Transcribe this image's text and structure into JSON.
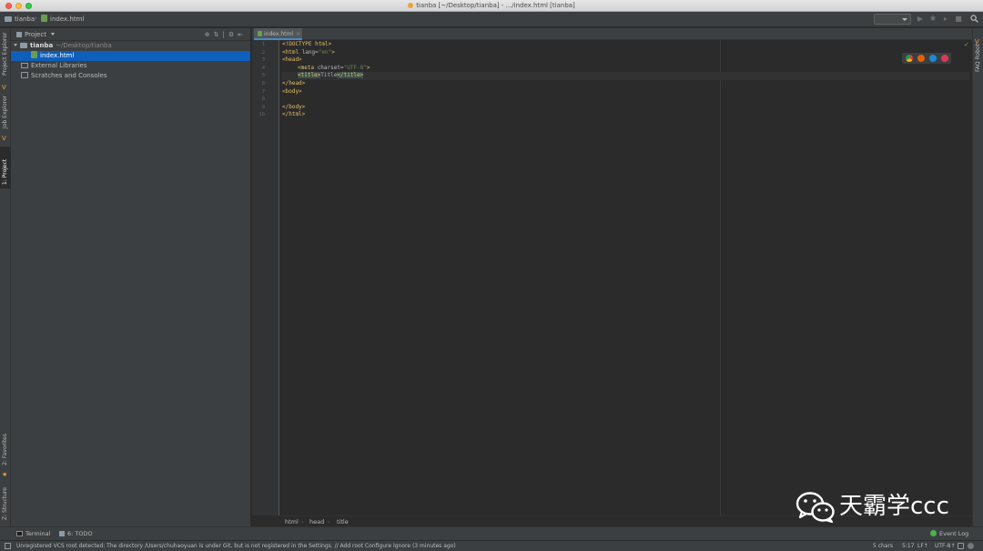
{
  "window": {
    "title": "tianba [~/Desktop/tianba] - .../index.html [tianba]"
  },
  "navbar": {
    "crumbs": [
      "tianba",
      "index.html"
    ]
  },
  "left_strip": {
    "tabs": [
      "Project Explorer",
      "Job Explorer",
      "1: Project",
      "2: Favorites",
      "Z: Structure"
    ]
  },
  "project_panel": {
    "title": "Project",
    "tree": {
      "root_name": "tianba",
      "root_path": "~/Desktop/tianba",
      "file": "index.html",
      "external": "External Libraries",
      "scratches": "Scratches and Consoles"
    }
  },
  "editor": {
    "tab_label": "index.html",
    "line_numbers": [
      "1",
      "2",
      "3",
      "4",
      "5",
      "6",
      "7",
      "8",
      "9",
      "10"
    ],
    "code": {
      "l1_tag": "<!DOCTYPE html>",
      "l2_open": "<html ",
      "l2_attr": "lang=",
      "l2_val": "\"en\"",
      "l2_close": ">",
      "l3": "<head>",
      "l4_open": "<meta ",
      "l4_attr": "charset=",
      "l4_val": "\"UTF-8\"",
      "l4_close": ">",
      "l5_open": "<title>",
      "l5_text": "Title",
      "l5_close": "</title>",
      "l6": "</head>",
      "l7": "<body>",
      "l9": "</body>",
      "l10": "</html>"
    },
    "breadcrumbs": [
      "html",
      "head",
      "title"
    ]
  },
  "right_strip": {
    "tabs": [
      "FAQ Robot"
    ]
  },
  "bottom_bar": {
    "terminal": "Terminal",
    "todo": "6: TODO",
    "event_log": "Event Log"
  },
  "status_bar": {
    "message": "Unregistered VCS root detected: The directory /Users/chuhaoyuan is under Git, but is not registered in the Settings. // Add root  Configure  Ignore (3 minutes ago)",
    "chars": "5 chars",
    "position": "5:17",
    "line_sep": "LF↑",
    "encoding": "UTF-8↑"
  },
  "watermark": {
    "text": "天霸学ccc"
  },
  "colors": {
    "editor_bg": "#2b2b2b",
    "panel_bg": "#3c3f41",
    "selection": "#0d5fbb",
    "tag": "#e8bf6a",
    "string": "#6a8759"
  }
}
